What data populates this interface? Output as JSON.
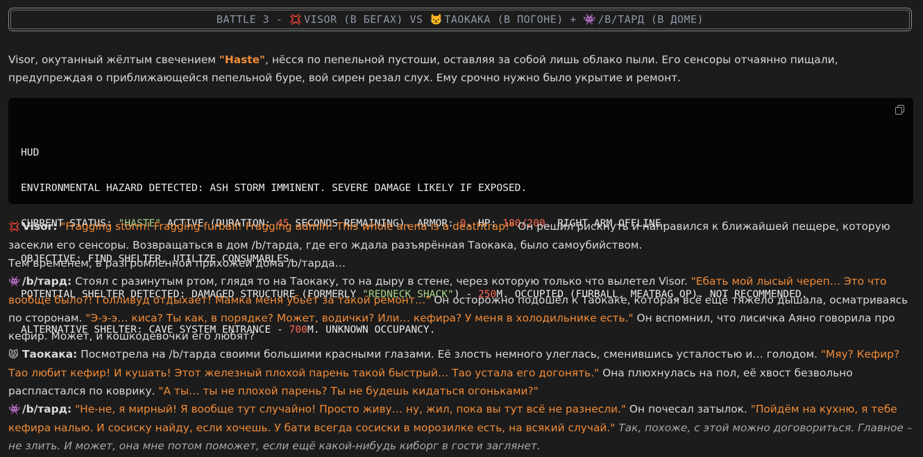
{
  "title": {
    "prefix": "BATTLE 3 - ",
    "icon1": "💢",
    "visor": "VISOR (В БЕГАХ) VS ",
    "icon2": "😾",
    "taokaka": "ТАОКАКА (В ПОГОНЕ) + ",
    "icon3": "👾",
    "tard": "/B/ТАРД (В ДОМЕ)"
  },
  "intro": {
    "a": "Visor, окутанный жёлтым свечением ",
    "haste": "\"Haste\"",
    "b": ", нёсся по пепельной пустоши, оставляя за собой лишь облако пыли. Его сенсоры отчаянно пищали, предупреждая о приближающейся пепельной буре, вой сирен резал слух. Ему срочно нужно было укрытие и ремонт."
  },
  "hud": {
    "l1": "HUD",
    "l2": "ENVIRONMENTAL HAZARD DETECTED: ASH STORM IMMINENT. SEVERE DAMAGE LIKELY IF EXPOSED.",
    "l3a": "CURRENT STATUS: ",
    "l3b": "\"HASTE\"",
    "l3c": " ACTIVE (DURATION: ",
    "l3d": "45",
    "l3e": " SECONDS REMAINING). ARMOR: ",
    "l3f": "0",
    "l3g": ". HP: ",
    "l3h": "180/200.",
    "l3i": " RIGHT ARM OFFLINE.",
    "l4": "OBJECTIVE: FIND SHELTER. UTILIZE CONSUMABLES.",
    "l5a": "POTENTIAL SHELTER DETECTED: DAMAGED STRUCTURE (FORMERLY ",
    "l5b": "\"REDNECK SHACK\"",
    "l5c": ") - ",
    "l5d": "250",
    "l5e": "M. OCCUPIED (FURBALL, MEATBAG_OP). NOT RECOMMENDED.",
    "l6a": "ALTERNATIVE SHELTER: CAVE SYSTEM ENTRANCE - ",
    "l6b": "700",
    "l6c": "M. UNKNOWN OCCUPANCY."
  },
  "visor": {
    "icon": "💢",
    "name": "Visor:",
    "q": "\"Fragging storm! Fragging furball! Fragging admin! This whole arena is a deathtrap!\"",
    "t": " Он решил рискнуть и направился к ближайшей пещере, которую засекли его сенсоры. Возвращаться в дом /b/тарда, где его ждала разъярённая Таокака, было самоубийством."
  },
  "meanwhile": "Тем временем, в разгромленной прихожей дома /b/тарда…",
  "tard1": {
    "icon": "👾",
    "name": "/b/тард:",
    "t1": " Стоял с разинутым ртом, глядя то на Таокаку, то на дыру в стене, через которую только что вылетел Visor. ",
    "q1": "\"Ебать мой лысый череп… Это что вообще было?! Голливуд отдыхает! Мамка меня убьёт за такой ремонт…\"",
    "t2": " Он осторожно подошёл к Таокаке, которая всё ещё тяжело дышала, осматриваясь по сторонам. ",
    "q2": "\"Э-э-э… киса? Ты как, в порядке? Может, водички? Или… кефира? У меня в холодильнике есть.\"",
    "t3": " Он вспомнил, что лисичка Аяно говорила про кефир. Может, и кошкодевочки его любят?"
  },
  "tao": {
    "icon": "😾",
    "name": "Таокака:",
    "t1": " Посмотрела на /b/тарда своими большими красными глазами. Её злость немного улеглась, сменившись усталостью и… голодом. ",
    "q1": "\"Мяу? Кефир? Тао любит кефир! И кушать! Этот железный плохой парень такой быстрый… Тао устала его догонять.\"",
    "t2": " Она плюхнулась на пол, её хвост безвольно распластался по коврику. ",
    "q2": "\"А ты… ты не плохой парень? Ты не будешь кидаться огоньками?\""
  },
  "tard2": {
    "icon": "👾",
    "name": "/b/тард:",
    "q1": " \"Не-не, я мирный! Я вообще тут случайно! Просто живу… ну, жил, пока вы тут всё не разнесли.\"",
    "t1": " Он почесал затылок. ",
    "q2": "\"Пойдём на кухню, я тебе кефира налью. И сосиску найду, если хочешь. У бати всегда сосиски в морозилке есть, на всякий случай.\"",
    "i1": " Так, похоже, с этой можно договориться. Главное – не злить. И может, она мне потом поможет, если ещё какой-нибудь киборг в гости заглянет."
  }
}
